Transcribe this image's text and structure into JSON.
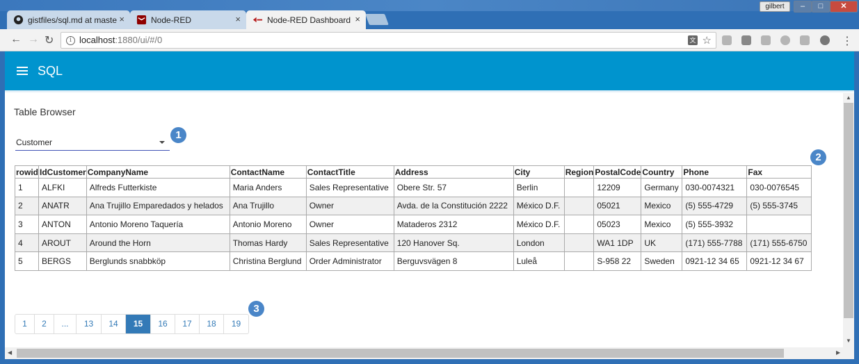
{
  "browser": {
    "tabs": [
      {
        "title": "gistfiles/sql.md at maste",
        "close": "×",
        "icon": "github-icon"
      },
      {
        "title": "Node-RED",
        "close": "×",
        "icon": "node-red-icon"
      },
      {
        "title": "Node-RED Dashboard",
        "close": "×",
        "icon": "node-red-dashboard-icon"
      }
    ],
    "user": "gilbert",
    "url_host": "localhost",
    "url_path": ":1880/ui/#/0",
    "window_buttons": {
      "minimize": "–",
      "maximize": "□",
      "close": "✕"
    }
  },
  "app": {
    "title": "SQL",
    "accent_color": "#0094ce"
  },
  "section": {
    "title": "Table Browser"
  },
  "table_select": {
    "value": "Customer"
  },
  "table": {
    "columns": [
      "rowid",
      "IdCustomer",
      "CompanyName",
      "ContactName",
      "ContactTitle",
      "Address",
      "City",
      "Region",
      "PostalCode",
      "Country",
      "Phone",
      "Fax"
    ],
    "rows": [
      [
        "1",
        "ALFKI",
        "Alfreds Futterkiste",
        "Maria Anders",
        "Sales Representative",
        "Obere Str. 57",
        "Berlin",
        "",
        "12209",
        "Germany",
        "030-0074321",
        "030-0076545"
      ],
      [
        "2",
        "ANATR",
        "Ana Trujillo Emparedados y helados",
        "Ana Trujillo",
        "Owner",
        "Avda. de la Constitución 2222",
        "México D.F.",
        "",
        "05021",
        "Mexico",
        "(5) 555-4729",
        "(5) 555-3745"
      ],
      [
        "3",
        "ANTON",
        "Antonio Moreno Taquería",
        "Antonio Moreno",
        "Owner",
        "Mataderos 2312",
        "México D.F.",
        "",
        "05023",
        "Mexico",
        "(5) 555-3932",
        ""
      ],
      [
        "4",
        "AROUT",
        "Around the Horn",
        "Thomas Hardy",
        "Sales Representative",
        "120 Hanover Sq.",
        "London",
        "",
        "WA1 1DP",
        "UK",
        "(171) 555-7788",
        "(171) 555-6750"
      ],
      [
        "5",
        "BERGS",
        "Berglunds snabbköp",
        "Christina Berglund",
        "Order Administrator",
        "Berguvsvägen 8",
        "Luleå",
        "",
        "S-958 22",
        "Sweden",
        "0921-12 34 65",
        "0921-12 34 67"
      ]
    ]
  },
  "pagination": {
    "pages": [
      "1",
      "2",
      "...",
      "13",
      "14",
      "15",
      "16",
      "17",
      "18",
      "19"
    ],
    "active": "15"
  },
  "callouts": [
    "1",
    "2",
    "3"
  ]
}
